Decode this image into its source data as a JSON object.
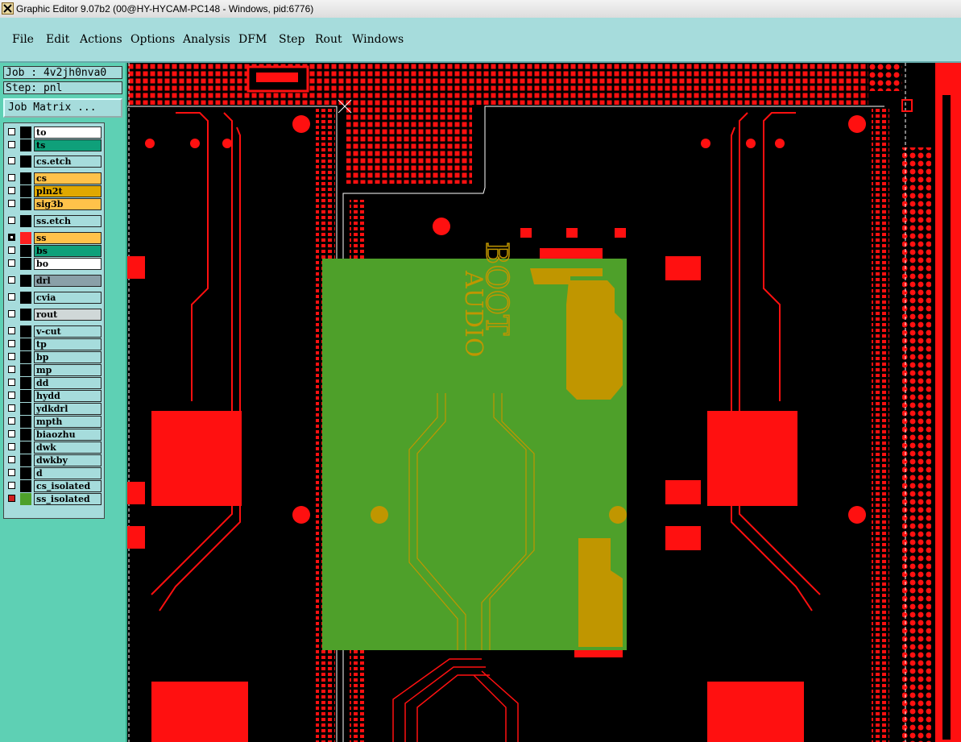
{
  "window": {
    "title": "Graphic Editor 9.07b2 (00@HY-HYCAM-PC148 - Windows, pid:6776)",
    "app_icon": "close-x-icon"
  },
  "menu": {
    "items": [
      {
        "label": "File"
      },
      {
        "label": "Edit"
      },
      {
        "label": "Actions"
      },
      {
        "label": "Options"
      },
      {
        "label": "Analysis"
      },
      {
        "label": "DFM"
      },
      {
        "label": "Step"
      },
      {
        "label": "Rout"
      },
      {
        "label": "Windows"
      }
    ]
  },
  "panel": {
    "job": "Job : 4v2jh0nva0",
    "step": "Step: pnl",
    "job_matrix_button": "Job Matrix ..."
  },
  "layers": [
    {
      "name": "to",
      "color": "#ffffff",
      "swatch": "#000000",
      "state": "off"
    },
    {
      "name": "ts",
      "color": "#0fa07a",
      "swatch": "#000000",
      "state": "off"
    },
    {
      "name": "cs.etch",
      "color": "#a6dcdc",
      "swatch": "#000000",
      "state": "off"
    },
    {
      "name": "cs",
      "color": "#ffc24a",
      "swatch": "#000000",
      "state": "off"
    },
    {
      "name": "pln2t",
      "color": "#e0a800",
      "swatch": "#000000",
      "state": "off"
    },
    {
      "name": "sig3b",
      "color": "#ffc24a",
      "swatch": "#000000",
      "state": "off"
    },
    {
      "name": "ss.etch",
      "color": "#a6dcdc",
      "swatch": "#000000",
      "state": "off"
    },
    {
      "name": "ss",
      "color": "#ffc24a",
      "swatch": "#ff2020",
      "state": "active"
    },
    {
      "name": "bs",
      "color": "#0fa07a",
      "swatch": "#000000",
      "state": "off"
    },
    {
      "name": "bo",
      "color": "#ffffff",
      "swatch": "#000000",
      "state": "off"
    },
    {
      "name": "drl",
      "color": "#8aa0a8",
      "swatch": "#000000",
      "state": "off"
    },
    {
      "name": "cvia",
      "color": "#a6dcdc",
      "swatch": "#000000",
      "state": "off"
    },
    {
      "name": "rout",
      "color": "#d0d8d8",
      "swatch": "#000000",
      "state": "off"
    },
    {
      "name": "v-cut",
      "color": "#a6dcdc",
      "swatch": "#000000",
      "state": "off"
    },
    {
      "name": "tp",
      "color": "#a6dcdc",
      "swatch": "#000000",
      "state": "off"
    },
    {
      "name": "bp",
      "color": "#a6dcdc",
      "swatch": "#000000",
      "state": "off"
    },
    {
      "name": "mp",
      "color": "#a6dcdc",
      "swatch": "#000000",
      "state": "off"
    },
    {
      "name": "dd",
      "color": "#a6dcdc",
      "swatch": "#000000",
      "state": "off"
    },
    {
      "name": "hydd",
      "color": "#a6dcdc",
      "swatch": "#000000",
      "state": "off"
    },
    {
      "name": "ydkdrl",
      "color": "#a6dcdc",
      "swatch": "#000000",
      "state": "off"
    },
    {
      "name": "mpth",
      "color": "#a6dcdc",
      "swatch": "#000000",
      "state": "off"
    },
    {
      "name": "biaozhu",
      "color": "#a6dcdc",
      "swatch": "#000000",
      "state": "off"
    },
    {
      "name": "dwk",
      "color": "#a6dcdc",
      "swatch": "#000000",
      "state": "off"
    },
    {
      "name": "dwkby",
      "color": "#a6dcdc",
      "swatch": "#000000",
      "state": "off"
    },
    {
      "name": "d",
      "color": "#a6dcdc",
      "swatch": "#000000",
      "state": "off"
    },
    {
      "name": "cs_isolated",
      "color": "#a6dcdc",
      "swatch": "#000000",
      "state": "off"
    },
    {
      "name": "ss_isolated",
      "color": "#a6dcdc",
      "swatch": "#4ea02a",
      "state": "red"
    }
  ],
  "canvas": {
    "background": "#000000",
    "copper_color": "#ff1010",
    "highlight_color": "#4ea02a",
    "silkscreen_text": "AUDIO",
    "silkscreen_text_2": "BOOT"
  }
}
